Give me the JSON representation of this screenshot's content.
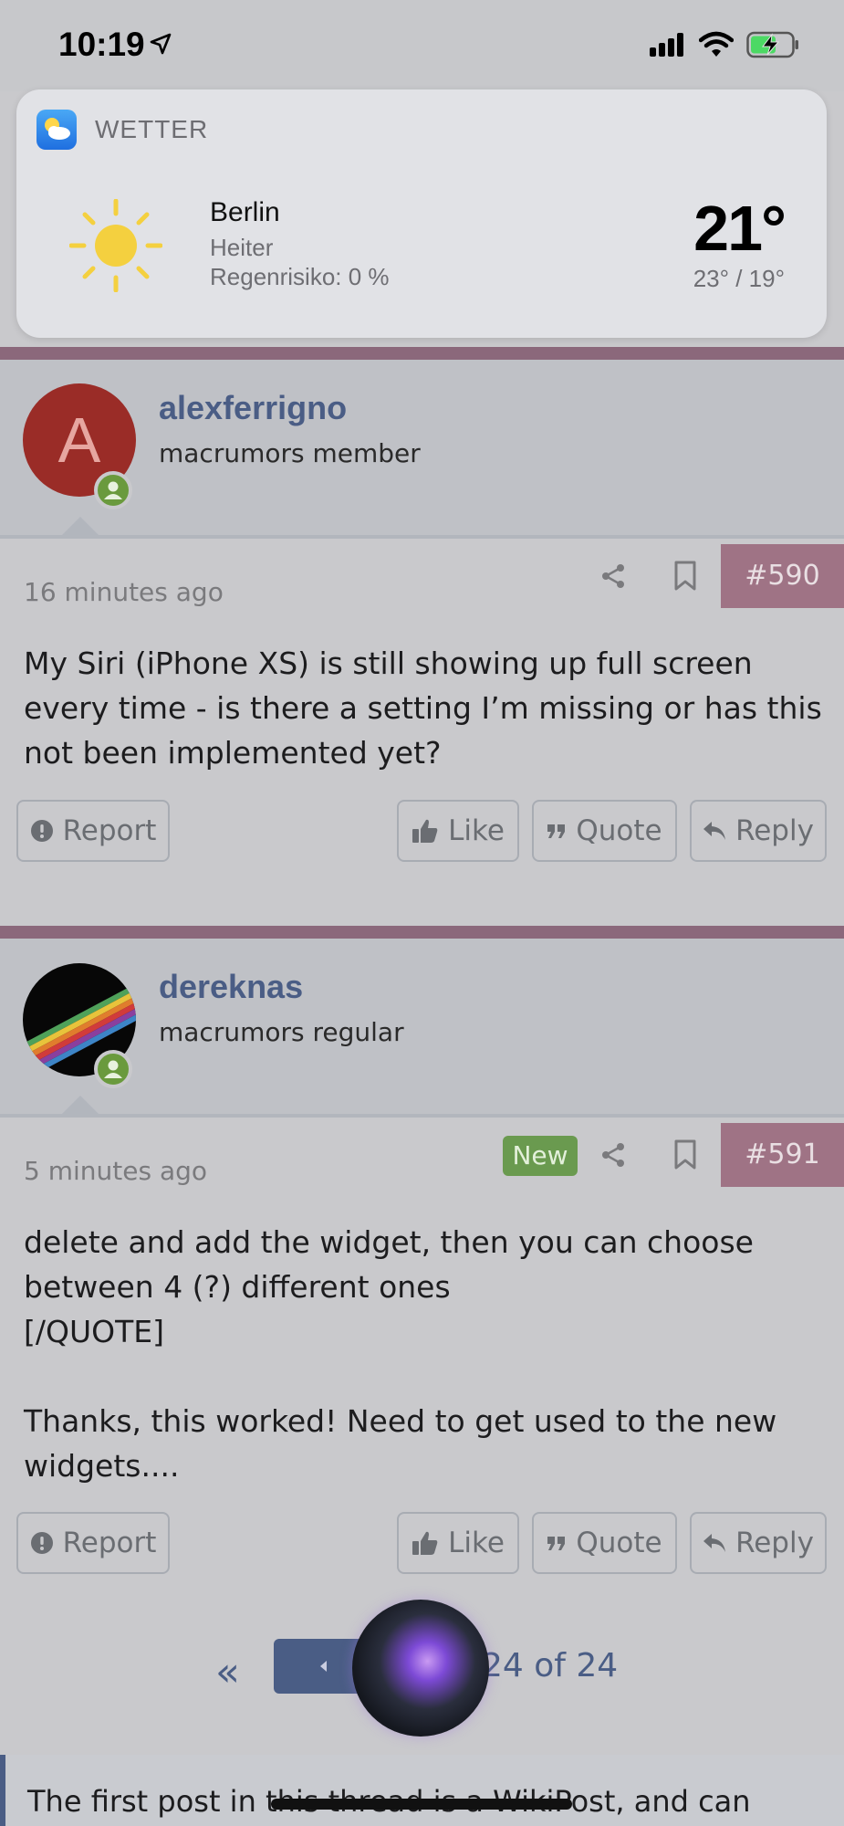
{
  "status_bar": {
    "time": "10:19",
    "icons": [
      "location-arrow-icon",
      "cellular-signal-icon",
      "wifi-icon",
      "battery-charging-icon"
    ]
  },
  "weather_widget": {
    "app_name": "WETTER",
    "city": "Berlin",
    "condition": "Heiter",
    "rain_chance": "Regenrisiko: 0 %",
    "temperature": "21°",
    "high_low": "23° / 19°",
    "icon": "sun-icon",
    "sun_color": "#f4d03f"
  },
  "posts": [
    {
      "username": "alexferrigno",
      "user_title": "macrumors member",
      "avatar_letter": "A",
      "time_ago": "16 minutes ago",
      "post_number": "#590",
      "is_new": false,
      "body": "My Siri (iPhone XS) is still showing up full screen every time - is there a setting I’m missing or has this not been implemented yet?",
      "actions": {
        "report": "Report",
        "like": "Like",
        "quote": "Quote",
        "reply": "Reply"
      }
    },
    {
      "username": "dereknas",
      "user_title": "macrumors regular",
      "time_ago": "5 minutes ago",
      "post_number": "#591",
      "is_new": true,
      "new_label": "New",
      "body": "delete and add the widget, then you can choose between 4 (?) different ones\n[/QUOTE]\n\nThanks, this worked! Need to get used to the new widgets....",
      "actions": {
        "report": "Report",
        "like": "Like",
        "quote": "Quote",
        "reply": "Reply"
      }
    }
  ],
  "pagination": {
    "first_symbol": "«",
    "page_label": "24 of 24"
  },
  "wiki_notice": "The first post in this thread is a WikiPost, and can",
  "colors": {
    "post_accent": "#8b687b",
    "link": "#4a5d85",
    "new_badge": "#6a9a4f",
    "online": "#6a9a3d"
  }
}
